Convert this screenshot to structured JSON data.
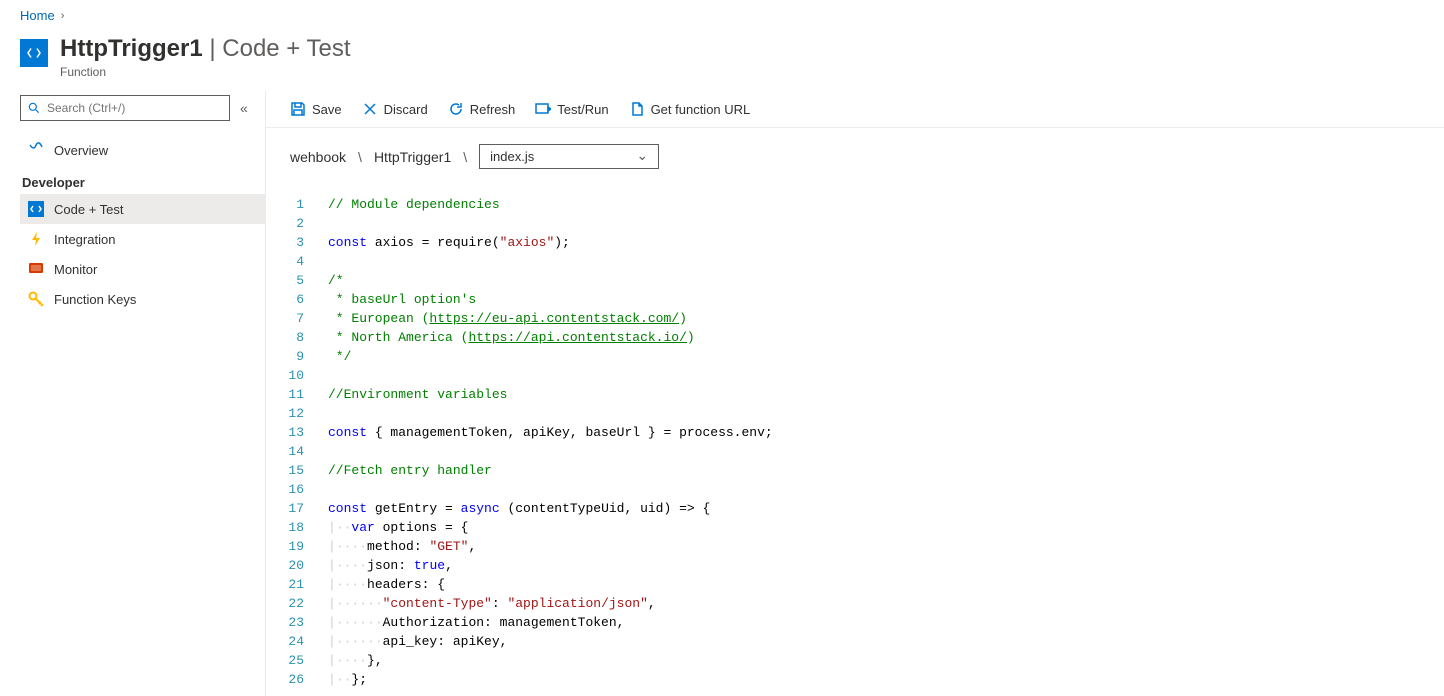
{
  "breadcrumb": {
    "home": "Home"
  },
  "title": {
    "name": "HttpTrigger1",
    "section": "Code + Test",
    "subtitle": "Function"
  },
  "search": {
    "placeholder": "Search (Ctrl+/)"
  },
  "sidebar": {
    "overview": "Overview",
    "section": "Developer",
    "items": [
      {
        "label": "Code + Test",
        "icon": "code"
      },
      {
        "label": "Integration",
        "icon": "bolt"
      },
      {
        "label": "Monitor",
        "icon": "monitor"
      },
      {
        "label": "Function Keys",
        "icon": "key"
      }
    ]
  },
  "toolbar": {
    "save": "Save",
    "discard": "Discard",
    "refresh": "Refresh",
    "testrun": "Test/Run",
    "geturl": "Get function URL"
  },
  "path": {
    "root": "wehbook",
    "func": "HttpTrigger1",
    "file": "index.js"
  },
  "code": {
    "lines": 26,
    "c1": "// Module dependencies",
    "c3_kw": "const",
    "c3_a": " axios = require(",
    "c3_str": "\"axios\"",
    "c3_b": ");",
    "c5": "/*",
    "c6": " * baseUrl option's",
    "c7a": " * European (",
    "c7_link": "https://eu-api.contentstack.com/",
    "c7b": ")",
    "c8a": " * North America (",
    "c8_link": "https://api.contentstack.io/",
    "c8b": ")",
    "c9": " */",
    "c11": "//Environment variables",
    "c13_kw": "const",
    "c13": " { managementToken, apiKey, baseUrl } = process.env;",
    "c15": "//Fetch entry handler",
    "c17_kw1": "const",
    "c17a": " getEntry = ",
    "c17_kw2": "async",
    "c17b": " (contentTypeUid, uid) => {",
    "c18_kw": "var",
    "c18": " options = {",
    "c19a": "method: ",
    "c19_str": "\"GET\"",
    "c19b": ",",
    "c20a": "json: ",
    "c20_kw": "true",
    "c20b": ",",
    "c21": "headers: {",
    "c22_str1": "\"content-Type\"",
    "c22a": ": ",
    "c22_str2": "\"application/json\"",
    "c22b": ",",
    "c23": "Authorization: managementToken,",
    "c24": "api_key: apiKey,",
    "c25": "},",
    "c26": "};"
  }
}
